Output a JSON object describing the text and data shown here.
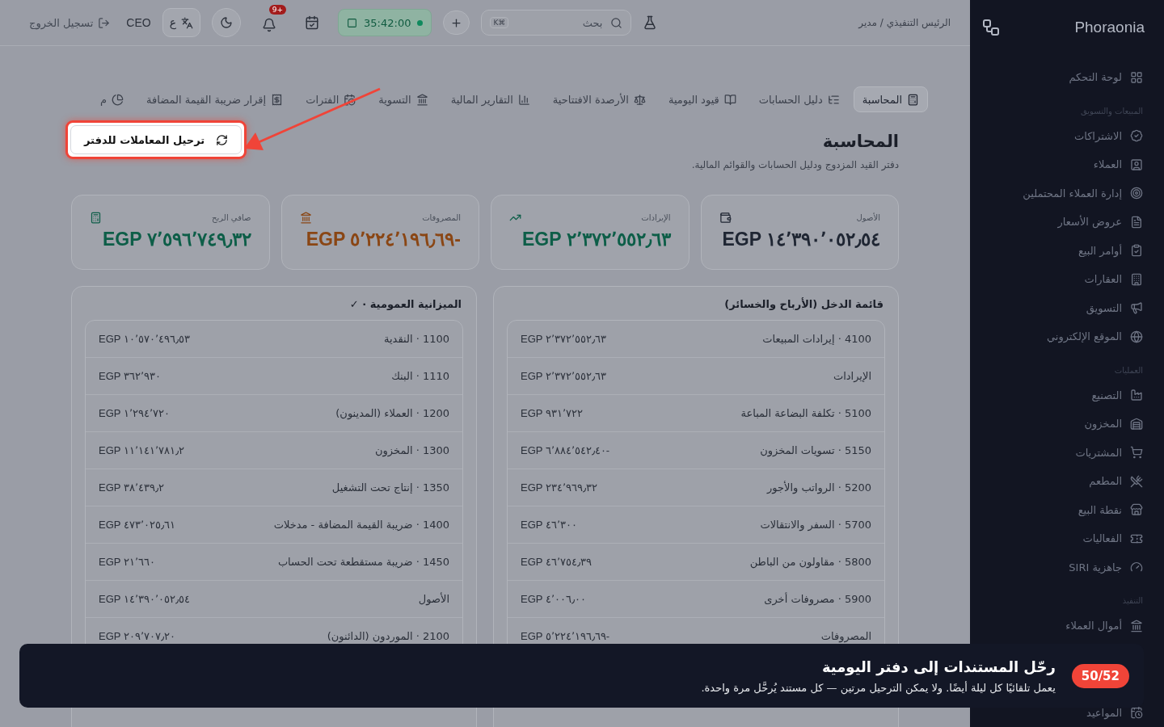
{
  "sidebar": {
    "brand": "Phoraonia",
    "sections": [
      {
        "items": [
          "لوحة التحكم"
        ]
      },
      {
        "title": "المبيعات والتسويق",
        "items": [
          "الاشتراكات",
          "العملاء",
          "إدارة العملاء المحتملين",
          "عروض الأسعار",
          "أوامر البيع",
          "العقارات",
          "التسويق",
          "الموقع الإلكتروني"
        ]
      },
      {
        "title": "العمليات",
        "items": [
          "التصنيع",
          "المخزون",
          "المشتريات",
          "المطعم",
          "نقطة البيع",
          "الفعاليات",
          "جاهزية SIRI"
        ]
      },
      {
        "title": "التنفيذ",
        "items": [
          "أموال العملاء",
          "المواعيد"
        ]
      }
    ]
  },
  "topbar": {
    "breadcrumb": "الرئيس التنفيذي / مدير",
    "search_placeholder": "بحث",
    "shortcut": "K⌘",
    "timer": "35:42:00",
    "notifications_badge": "+9",
    "language": "ع",
    "user": "CEO",
    "logout": "تسجيل الخروج"
  },
  "tabs": [
    {
      "label": "المحاسبة",
      "selected": true
    },
    {
      "label": "دليل الحسابات",
      "selected": false
    },
    {
      "label": "قيود اليومية",
      "selected": false
    },
    {
      "label": "الأرصدة الافتتاحية",
      "selected": false
    },
    {
      "label": "التقارير المالية",
      "selected": false
    },
    {
      "label": "التسوية",
      "selected": false
    },
    {
      "label": "الفترات",
      "selected": false
    },
    {
      "label": "إقرار ضريبة القيمة المضافة",
      "selected": false
    },
    {
      "label": "م",
      "selected": false
    }
  ],
  "header": {
    "title": "المحاسبة",
    "subtitle": "دفتر القيد المزدوج ودليل الحسابات والقوائم المالية.",
    "action": "ترحيل المعاملات للدفتر"
  },
  "stats": [
    {
      "label": "الأصول",
      "value": "EGP ١٤٬٣٩٠٬٠٥٢٫٥٤",
      "color": "#1f2633"
    },
    {
      "label": "الإيرادات",
      "value": "EGP ٢٬٣٧٢٬٥٥٢٫٦٣",
      "color": "#0d5e48"
    },
    {
      "label": "المصروفات",
      "value": "EGP ٥٬٢٢٤٬١٩٦٫٦٩-",
      "color": "#8a4614"
    },
    {
      "label": "صافي الربح",
      "value": "EGP ٧٬٥٩٦٬٧٤٩٫٣٢",
      "color": "#0d5e48"
    }
  ],
  "panels": [
    {
      "title": "قائمة الدخل (الأرباح والخسائر)",
      "rows": [
        {
          "account": "4100 · إيرادات المبيعات",
          "amount": "EGP ٢٬٣٧٢٬٥٥٢٫٦٣"
        },
        {
          "account": "الإيرادات",
          "amount": "EGP ٢٬٣٧٢٬٥٥٢٫٦٣"
        },
        {
          "account": "5100 · تكلفة البضاعة المباعة",
          "amount": "EGP ٩٣١٬٧٢٢"
        },
        {
          "account": "5150 · تسويات المخزون",
          "amount": "EGP ٦٬٨٨٤٬٥٤٢٫٤٠-"
        },
        {
          "account": "5200 · الرواتب والأجور",
          "amount": "EGP ٢٣٤٬٩٦٩٫٣٢"
        },
        {
          "account": "5700 · السفر والانتقالات",
          "amount": "EGP ٤٦٬٣٠٠"
        },
        {
          "account": "5800 · مقاولون من الباطن",
          "amount": "EGP ٤٦٬٧٥٤٫٣٩"
        },
        {
          "account": "5900 · مصروفات أخرى",
          "amount": "EGP ٤٬٠٠٦٫٠٠"
        },
        {
          "account": "المصروفات",
          "amount": "EGP ٥٬٢٢٤٬١٩٦٫٦٩-"
        }
      ]
    },
    {
      "title": "الميزانية العمومية · ✓",
      "rows": [
        {
          "account": "1100 · النقدية",
          "amount": "EGP ١٠٬٥٧٠٬٤٩٦٫٥٣"
        },
        {
          "account": "1110 · البنك",
          "amount": "EGP ٣٦٢٬٩٣٠"
        },
        {
          "account": "1200 · العملاء (المدينون)",
          "amount": "EGP ١٬٢٩٤٬٧٢٠"
        },
        {
          "account": "1300 · المخزون",
          "amount": "EGP ١١٬١٤١٬٧٨١٫٢"
        },
        {
          "account": "1350 · إنتاج تحت التشغيل",
          "amount": "EGP ٣٨٬٤٣٩٫٢"
        },
        {
          "account": "1400 · ضريبة القيمة المضافة - مدخلات",
          "amount": "EGP ٤٧٣٬٠٢٥٫٦١"
        },
        {
          "account": "1450 · ضريبة مستقطعة تحت الحساب",
          "amount": "EGP ٢١٬٦٦٠"
        },
        {
          "account": "الأصول",
          "amount": "EGP ١٤٬٣٩٠٬٠٥٢٫٥٤"
        },
        {
          "account": "2100 · الموردون (الدائنون)",
          "amount": "EGP ٢٠٩٬٧٠٧٫٢٠"
        }
      ]
    }
  ],
  "tour": {
    "counter": "50/52",
    "title": "رحّل المستندات إلى دفتر اليومية",
    "text": "يعمل تلقائيًا كل ليلة أيضًا. ولا يمكن الترحيل مرتين — كل مستند يُرحَّل مرة واحدة."
  }
}
